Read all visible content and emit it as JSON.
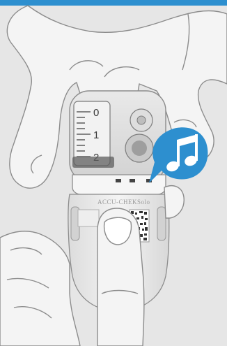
{
  "device": {
    "brand": "ACCU-CHEK",
    "model": "Solo",
    "scale_labels": [
      "0",
      "1",
      "2"
    ]
  },
  "notification": {
    "icon": "music-note-icon",
    "color": "#2d8fcf"
  },
  "colors": {
    "top_bar": "#2d8fcf",
    "background": "#e6e6e6"
  }
}
